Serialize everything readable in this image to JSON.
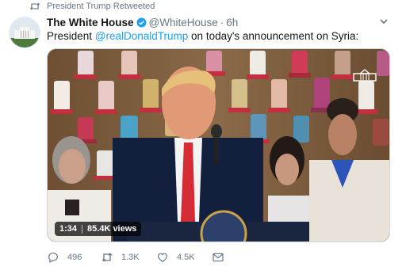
{
  "retweet": {
    "label": "President Trump Retweeted",
    "icon": "retweet-icon"
  },
  "tweet": {
    "display_name": "The White House",
    "handle": "@WhiteHouse",
    "separator": "·",
    "time": "6h",
    "text_before": "President ",
    "mention": "@realDonaldTrump",
    "text_after": " on today's announcement on Syria:"
  },
  "media": {
    "duration": "1:34",
    "views": "85.4K views",
    "overlay_icon": "white-house-logo"
  },
  "actions": {
    "reply_count": "496",
    "retweet_count": "1.3K",
    "like_count": "4.5K"
  },
  "colors": {
    "accent": "#1da1f2",
    "muted": "#657786",
    "text": "#14171a"
  }
}
